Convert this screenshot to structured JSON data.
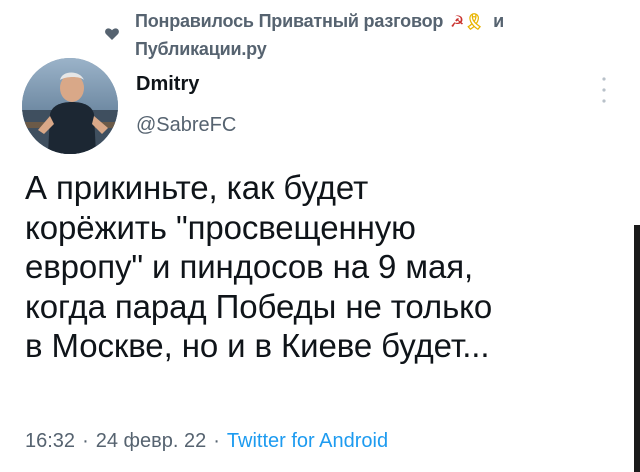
{
  "social_context": {
    "prefix": "Понравилось Приватный разговор",
    "emoji_1": "☭",
    "emoji_2": "🎗",
    "suffix": "и",
    "line2": "Публикации.ру",
    "icon": "heart-icon"
  },
  "author": {
    "display_name": "Dmitry",
    "handle": "@SabreFC",
    "avatar_icon": "avatar-photo"
  },
  "tweet": {
    "text": "А прикиньте, как будет\nкорёжить \"просвещенную\nевропу\" и пиндосов на 9 мая,\nкогда парад Победы не только\nв Москве, но и в Киеве будет...",
    "time": "16:32",
    "separator": "·",
    "date": "24 февр. 22",
    "source": "Twitter for Android"
  },
  "colors": {
    "text": "#0f1419",
    "muted": "#566370",
    "link": "#1d9bf0",
    "background": "#ffffff"
  }
}
